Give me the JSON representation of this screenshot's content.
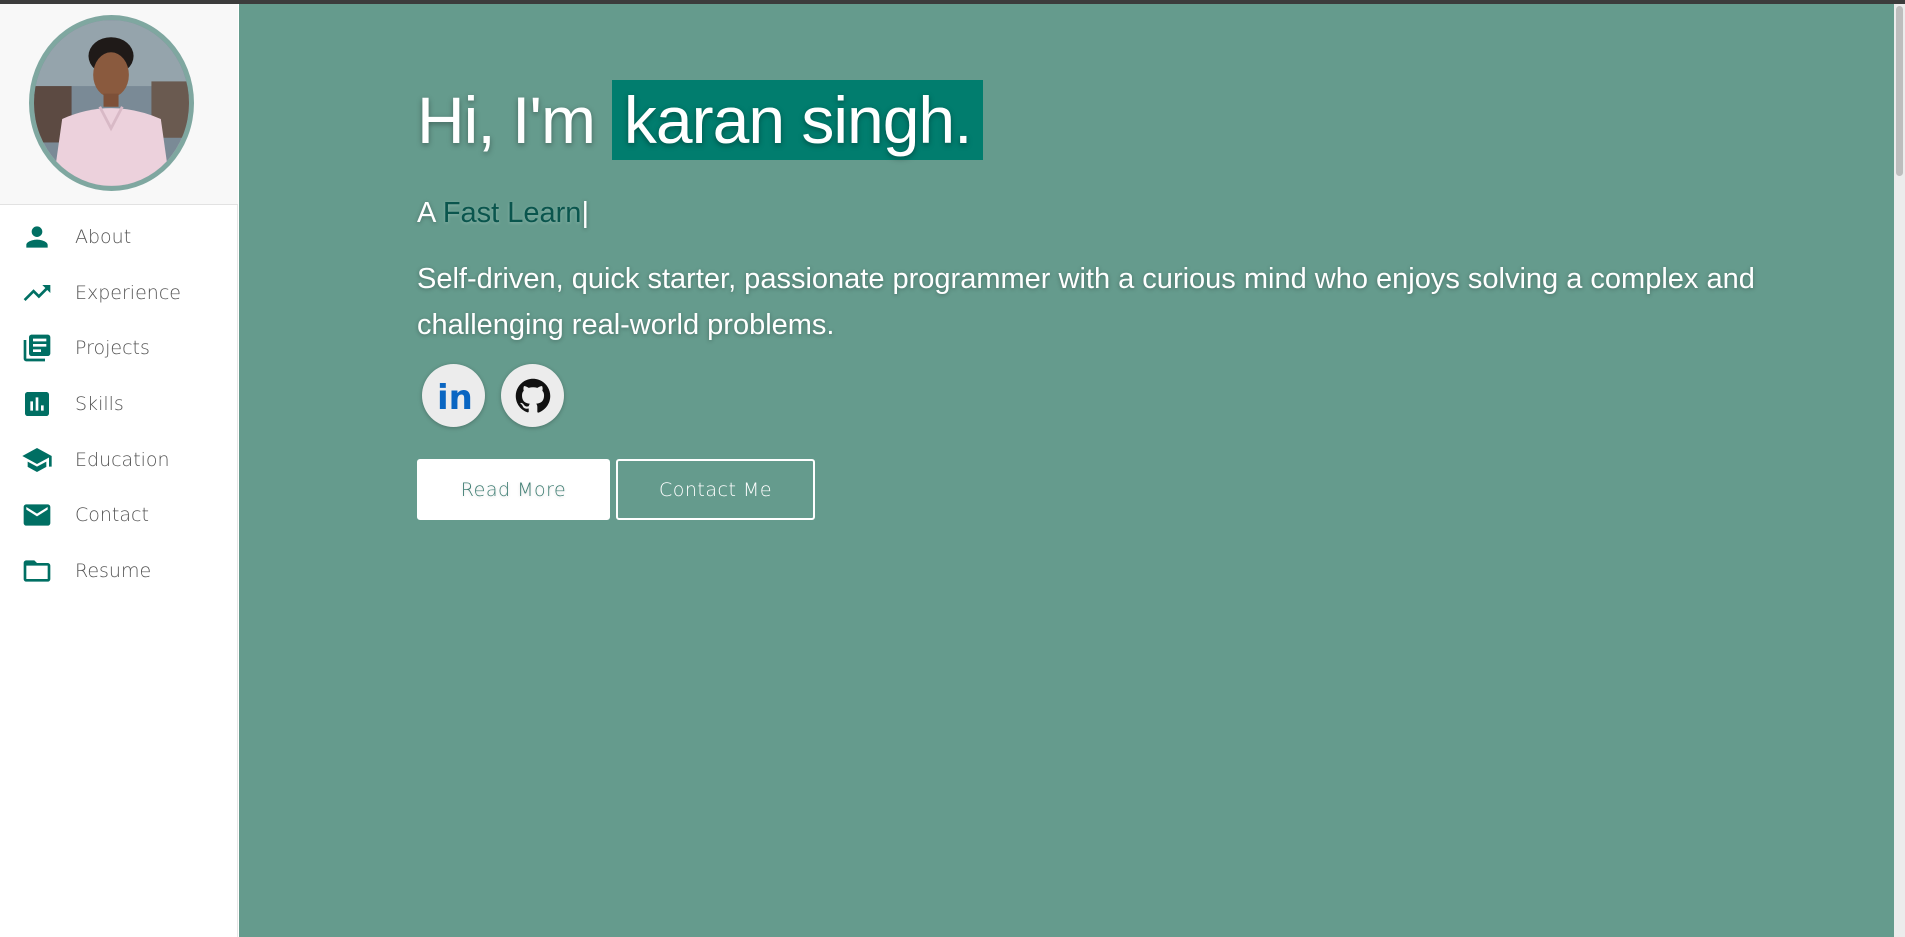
{
  "sidebar": {
    "items": [
      {
        "label": "About",
        "icon": "person-icon"
      },
      {
        "label": "Experience",
        "icon": "trending-up-icon"
      },
      {
        "label": "Projects",
        "icon": "library-books-icon"
      },
      {
        "label": "Skills",
        "icon": "bar-chart-icon"
      },
      {
        "label": "Education",
        "icon": "school-icon"
      },
      {
        "label": "Contact",
        "icon": "mail-icon"
      },
      {
        "label": "Resume",
        "icon": "folder-icon"
      }
    ]
  },
  "hero": {
    "greeting": "Hi, I'm",
    "name": "karan singh.",
    "tagline_prefix": "A",
    "tagline_typed": "Fast Learn",
    "cursor": "|",
    "description": "Self-driven, quick starter, passionate programmer with a curious mind who enjoys solving a complex and challenging real-world problems.",
    "socials": [
      {
        "name": "linkedin",
        "icon": "linkedin-icon",
        "text": "in"
      },
      {
        "name": "github",
        "icon": "github-icon"
      }
    ],
    "read_more_label": "Read More",
    "contact_label": "Contact Me"
  },
  "colors": {
    "main_bg": "#659b8d",
    "accent": "#017d6e",
    "icon_color": "#006f63"
  }
}
